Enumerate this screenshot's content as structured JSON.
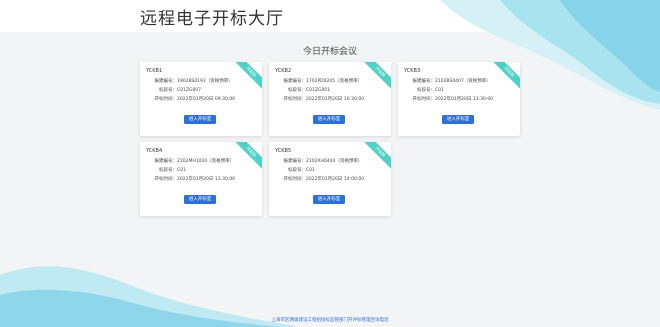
{
  "header": {
    "title": "远程电子开标大厅"
  },
  "section": {
    "title": "今日开标会议"
  },
  "labels": {
    "registration_no": "报建编号：",
    "section_no": "标段号：",
    "open_time": "开标时间："
  },
  "cards": [
    {
      "code": "YCKB1",
      "status": "开标前",
      "registration_no": "1902BS0193（资格预审）",
      "section_no": "C01ZG007",
      "open_time": "2022年01月20日 09:30:00",
      "button": "进入开标室"
    },
    {
      "code": "YCKB2",
      "status": "开标前",
      "registration_no": "1702PD0205（资格预审）",
      "section_no": "C01ZG001",
      "open_time": "2022年01月20日 10:30:00",
      "button": "进入开标室"
    },
    {
      "code": "YCKB3",
      "status": "开标前",
      "registration_no": "2102BS0407（资格预审）",
      "section_no": "C01",
      "open_time": "2022年01月20日 13:30:00",
      "button": "进入开标室"
    },
    {
      "code": "YCKB4",
      "status": "开标前",
      "registration_no": "2102MH1010（资格预审）",
      "section_no": "C01",
      "open_time": "2022年01月20日 13:30:00",
      "button": "进入开标室"
    },
    {
      "code": "YCKB5",
      "status": "开标前",
      "registration_no": "2102XH0444（资格预审）",
      "section_no": "C01",
      "open_time": "2022年01月20日 14:00:00",
      "button": "进入开标室"
    }
  ],
  "footer": {
    "text": "上海市区两级建设工程招投标监管部门开评标管理咨询电话"
  },
  "colors": {
    "accent": "#2f6fd6",
    "ribbon": "#4fd1c5",
    "background": "#f3f4f6"
  }
}
